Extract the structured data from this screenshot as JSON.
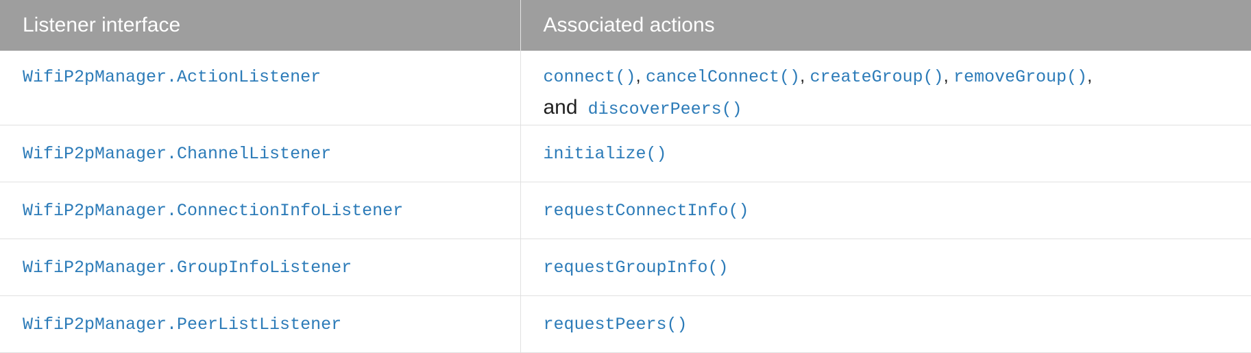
{
  "table": {
    "headers": [
      "Listener interface",
      "Associated actions"
    ],
    "rows": [
      {
        "listener": "WifiP2pManager.ActionListener",
        "actions": [
          "connect()",
          "cancelConnect()",
          "createGroup()",
          "removeGroup()"
        ],
        "separator": ", ",
        "trailing_separator": ",",
        "conjunction": "and",
        "last_action": "discoverPeers()"
      },
      {
        "listener": "WifiP2pManager.ChannelListener",
        "action": "initialize()"
      },
      {
        "listener": "WifiP2pManager.ConnectionInfoListener",
        "action": "requestConnectInfo()"
      },
      {
        "listener": "WifiP2pManager.GroupInfoListener",
        "action": "requestGroupInfo()"
      },
      {
        "listener": "WifiP2pManager.PeerListListener",
        "action": "requestPeers()"
      }
    ]
  },
  "colors": {
    "header_bg": "#9e9e9e",
    "header_text": "#ffffff",
    "code_text": "#2c7bb8",
    "plain_text": "#212121",
    "border": "#e0e0e0"
  }
}
